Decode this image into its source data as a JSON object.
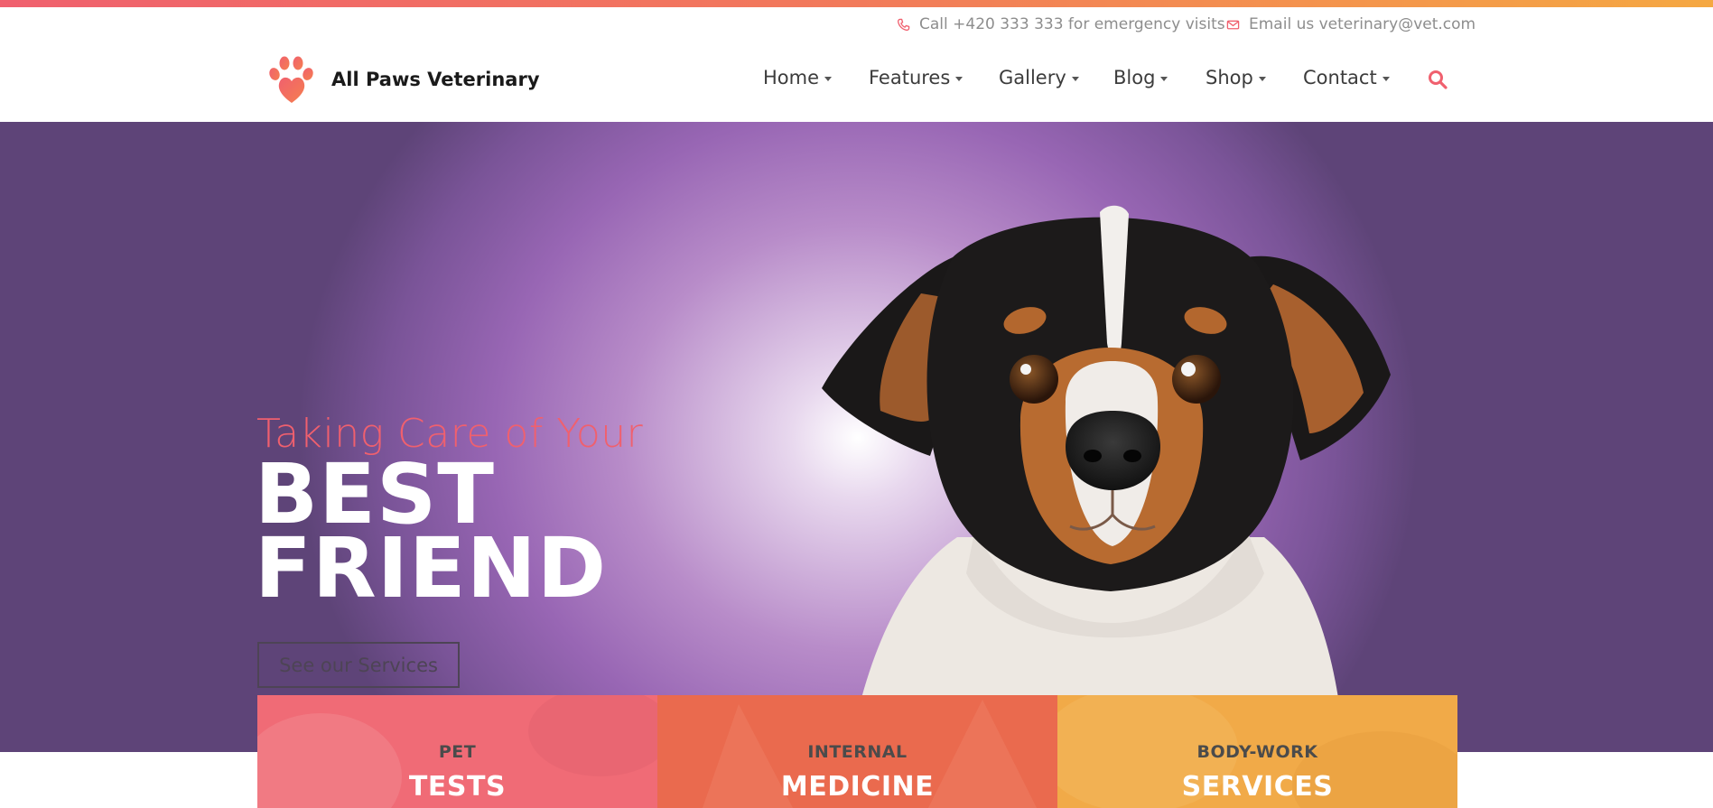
{
  "colors": {
    "accent": "#f0606e",
    "card_1": "#f06b76",
    "card_2": "#ea6a4e",
    "card_3": "#f1aa48",
    "hero_purple": "#9866b4"
  },
  "topbar": {
    "phone_icon": "phone-icon",
    "phone_text": "Call +420 333 333 for emergency visits",
    "email_icon": "envelope-icon",
    "email_text": "Email us veterinary@vet.com"
  },
  "header": {
    "logo_icon": "paw-heart-icon",
    "brand": "All Paws Veterinary",
    "nav": [
      {
        "label": "Home"
      },
      {
        "label": "Features"
      },
      {
        "label": "Gallery"
      },
      {
        "label": "Blog"
      },
      {
        "label": "Shop"
      },
      {
        "label": "Contact"
      }
    ],
    "search_icon": "search-icon"
  },
  "hero": {
    "tagline": "Taking Care of Your",
    "headline_line1": "BEST",
    "headline_line2": "FRIEND",
    "cta_label": "See our Services",
    "image": "dog-portrait"
  },
  "cards": [
    {
      "kicker": "PET",
      "title": "TESTS"
    },
    {
      "kicker": "INTERNAL",
      "title": "MEDICINE"
    },
    {
      "kicker": "BODY-WORK",
      "title": "SERVICES"
    }
  ]
}
